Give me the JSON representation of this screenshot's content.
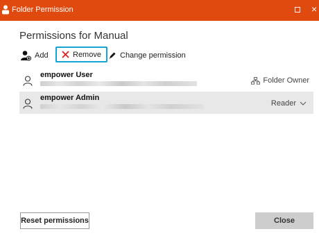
{
  "window": {
    "title": "Folder Permission",
    "accent_color": "#e04a0f",
    "close_glyph": "×"
  },
  "header": {
    "title": "Permissions for Manual"
  },
  "toolbar": {
    "add_label": "Add",
    "remove_label": "Remove",
    "change_label": "Change permission",
    "remove_highlight_color": "#15a3d4"
  },
  "users": [
    {
      "name": "empower User",
      "role": "Folder Owner"
    },
    {
      "name": "empower Admin",
      "role": "Reader"
    }
  ],
  "footer": {
    "reset_label": "Reset permissions",
    "close_label": "Close"
  }
}
